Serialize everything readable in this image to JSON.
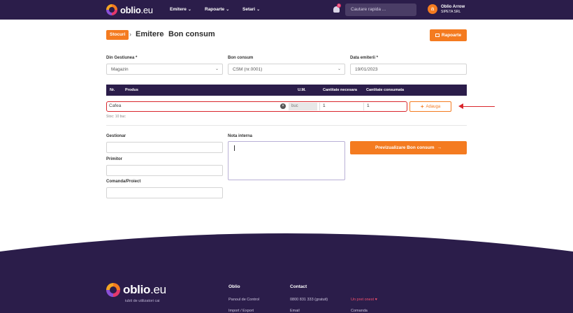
{
  "nav": {
    "brand_main": "oblio",
    "brand_suffix": ".eu",
    "menu": [
      "Emitere",
      "Rapoarte",
      "Setari"
    ],
    "notification_count": "1",
    "search_placeholder": "Cautare rapida ...",
    "avatar_initial": "a",
    "user_name": "Oblio Arrow",
    "user_company": "SIPETA SRL"
  },
  "breadcrumb": {
    "badge": "Stocuri",
    "items": [
      "Emitere",
      "Bon consum"
    ]
  },
  "reports_button": "Rapoarte",
  "form": {
    "gestiune_label": "Din Gestiunea *",
    "gestiune_value": "Magazin",
    "bon_label": "Bon consum",
    "bon_value": "CSM (nr.0001)",
    "data_label": "Data emiterii *",
    "data_value": "19/01/2023"
  },
  "table": {
    "columns": [
      "Nr.",
      "Produs",
      "U.M.",
      "Cantitate necesara",
      "Cantitate consumata"
    ],
    "row": {
      "product": "Cafea",
      "um": "buc",
      "qty_needed": "1",
      "qty_consumed": "1",
      "stock_note": "Stoc: 10 buc"
    },
    "add_button": "Adauga"
  },
  "details": {
    "gestionar_label": "Gestionar",
    "primitor_label": "Primitor",
    "comanda_label": "Comanda/Proiect",
    "nota_label": "Nota interna",
    "preview_button": "Previzualizare Bon consum"
  },
  "footer": {
    "brand_main": "oblio",
    "brand_suffix": ".eu",
    "tagline": "iubit de utilizatori cai",
    "col1_title": "Oblio",
    "col1_links": [
      "Panoul de Control",
      "Import / Export"
    ],
    "col2_title": "Contact",
    "col2_links": [
      "0800 831 333 (gratuit)",
      "Email"
    ],
    "col3_accent": "Un pret onest",
    "col3_link": "Comanda"
  },
  "colors": {
    "nav_bg": "#2b1d4a",
    "accent": "#f47b20",
    "highlight": "#d9262c"
  }
}
